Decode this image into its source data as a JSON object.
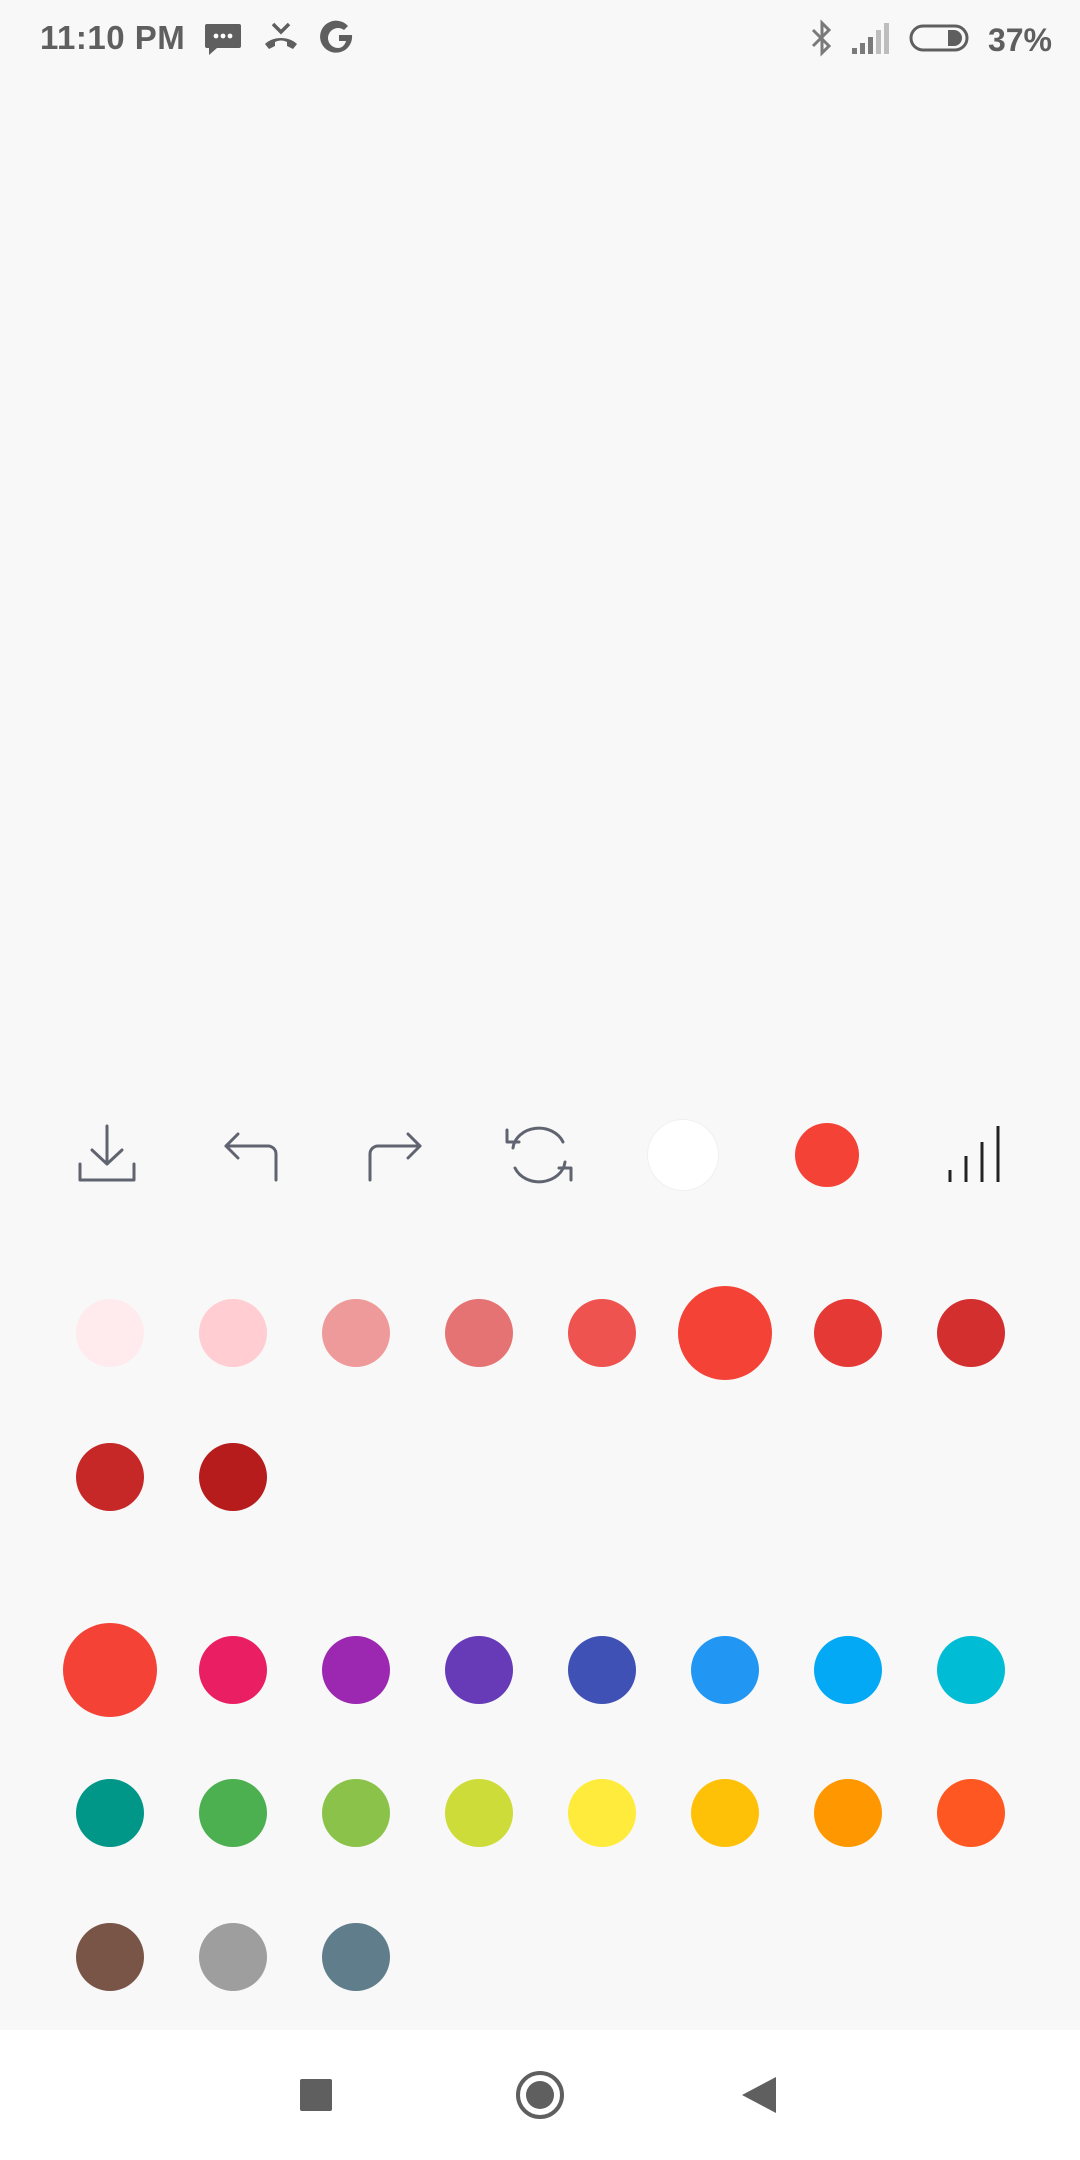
{
  "status_bar": {
    "time": "11:10 PM",
    "battery": "37%",
    "left_icons": [
      "message-icon",
      "missed-call-icon",
      "google-icon"
    ],
    "right_icons": [
      "bluetooth-icon",
      "signal-icon",
      "battery-icon"
    ]
  },
  "toolbar": {
    "tools": [
      "download-icon",
      "undo-icon",
      "redo-icon",
      "refresh-icon",
      "eraser-color",
      "current-color",
      "stroke-width-icon"
    ],
    "current_color": "#f44336",
    "eraser_color": "#ffffff"
  },
  "shades": [
    "#ffebee",
    "#ffcdd2",
    "#ef9a9a",
    "#e57373",
    "#ef5350",
    "#f44336",
    "#e53935",
    "#d32f2f",
    "#c62828",
    "#b71c1c"
  ],
  "selected_shade": "#f44336",
  "palette": [
    "#f44336",
    "#e91e63",
    "#9c27b0",
    "#673ab7",
    "#3f51b5",
    "#2196f3",
    "#03a9f4",
    "#00bcd4",
    "#009688",
    "#4caf50",
    "#8bc34a",
    "#cddc39",
    "#ffeb3b",
    "#ffc107",
    "#ff9800",
    "#ff5722",
    "#795548",
    "#9e9e9e",
    "#607d8b"
  ],
  "selected_palette": "#f44336",
  "nav": [
    "recents-button",
    "home-button",
    "back-button"
  ]
}
